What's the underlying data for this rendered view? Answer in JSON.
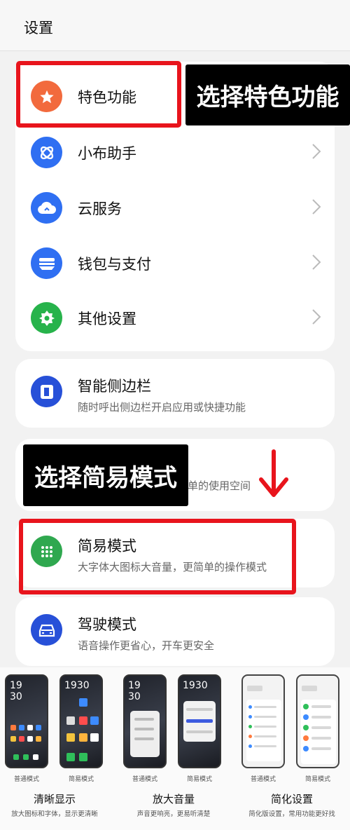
{
  "header": {
    "title": "设置"
  },
  "group1": {
    "items": [
      {
        "label": "特色功能",
        "icon": "star-icon",
        "color": "#f26a3d"
      },
      {
        "label": "小布助手",
        "icon": "assistant-icon",
        "color": "#2f6ff2"
      },
      {
        "label": "云服务",
        "icon": "cloud-icon",
        "color": "#2f6ff2"
      },
      {
        "label": "钱包与支付",
        "icon": "wallet-icon",
        "color": "#2f6ff2"
      },
      {
        "label": "其他设置",
        "icon": "gear-icon",
        "color": "#27b34b"
      }
    ]
  },
  "sidebar": {
    "label": "智能侧边栏",
    "sub": "随时呼出侧边栏开启应用或快捷功能",
    "icon": "sidebar-icon",
    "color": "#2750d8"
  },
  "hidden_item": {
    "sub": "单的使用空间"
  },
  "simple_mode": {
    "label": "简易模式",
    "sub": "大字体大图标大音量，更简单的操作模式",
    "icon": "grid-dots-icon",
    "color": "#2fa84f"
  },
  "driving_mode": {
    "label": "驾驶模式",
    "sub": "语音操作更省心，开车更安全",
    "icon": "car-icon",
    "color": "#2750d8"
  },
  "annotations": {
    "tag1": "选择特色功能",
    "tag2": "选择简易模式",
    "highlight_color": "#e8141c",
    "arrow": "down-arrow-icon"
  },
  "preview": {
    "clock_a": "19",
    "clock_b": "30",
    "clock_inline": "1930",
    "captions": [
      "普通模式",
      "简易模式",
      "普通模式",
      "简易模式",
      "普通模式",
      "简易模式"
    ],
    "groups": [
      {
        "title": "清晰显示",
        "sub": "放大图标和字体，显示更清晰"
      },
      {
        "title": "放大音量",
        "sub": "声音更响亮，更易听清楚"
      },
      {
        "title": "简化设置",
        "sub": "简化版设置，常用功能更好找"
      }
    ]
  }
}
